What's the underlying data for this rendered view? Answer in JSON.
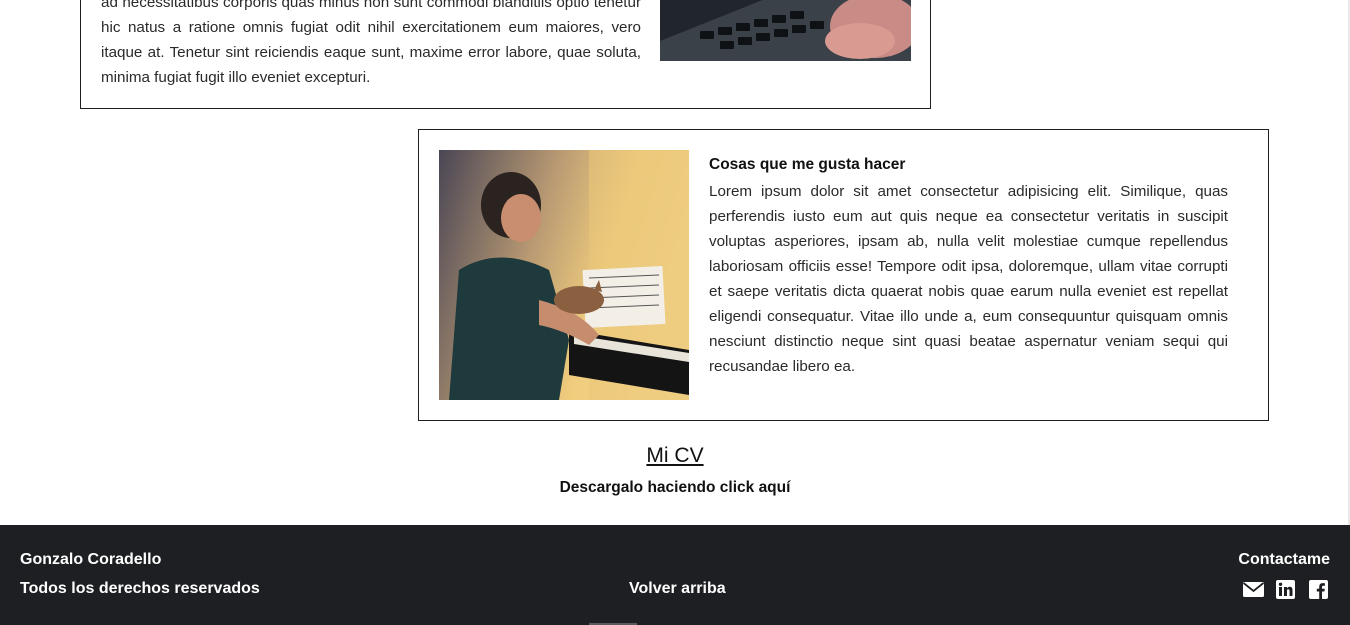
{
  "cards": [
    {
      "text": "ad necessitatibus corporis quas minus non sunt commodi blanditiis optio tenetur hic natus a ratione omnis fugiat odit nihil exercitationem eum maiores, vero itaque at. Tenetur sint reiciendis eaque sunt, maxime error labore, quae soluta, minima fugiat fugit illo eveniet excepturi."
    },
    {
      "title": "Cosas que me gusta hacer",
      "text": "Lorem ipsum dolor sit amet consectetur adipisicing elit. Similique, quas perferendis iusto eum aut quis neque ea consectetur veritatis in suscipit voluptas asperiores, ipsam ab, nulla velit molestiae cumque repellendus laboriosam officiis esse! Tempore odit ipsa, doloremque, ullam vitae corrupti et saepe veritatis dicta quaerat nobis quae earum nulla eveniet est repellat eligendi consequatur. Vitae illo unde a, eum consequuntur quisquam omnis nesciunt distinctio neque sint quasi beatae aspernatur veniam sequi qui recusandae libero ea."
    }
  ],
  "cv": {
    "title": "Mi CV",
    "subtitle": "Descargalo haciendo click aquí"
  },
  "footer": {
    "name": "Gonzalo Coradello",
    "rights": "Todos los derechos reservados",
    "back_to_top": "Volver arriba",
    "contact": "Contactame",
    "icons": [
      "envelope-icon",
      "linkedin-icon",
      "facebook-icon"
    ]
  }
}
